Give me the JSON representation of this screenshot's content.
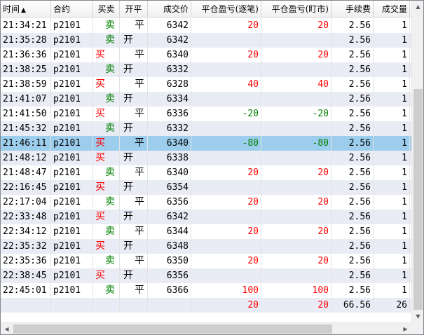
{
  "columns": [
    {
      "key": "time",
      "label": "时间",
      "sort_icon": "▲"
    },
    {
      "key": "contract",
      "label": "合约"
    },
    {
      "key": "side",
      "label": "买卖"
    },
    {
      "key": "offset",
      "label": "开平"
    },
    {
      "key": "price",
      "label": "成交价"
    },
    {
      "key": "pnl_close",
      "label": "平仓盈亏(逐笔)"
    },
    {
      "key": "pnl_mark",
      "label": "平仓盈亏(盯市)"
    },
    {
      "key": "fee",
      "label": "手续费"
    },
    {
      "key": "qty",
      "label": "成交量"
    }
  ],
  "colors": {
    "buy": "#ff0000",
    "sell": "#008000",
    "profit": "#ff0000",
    "loss": "#008000",
    "selected_row": "#9ccdec"
  },
  "rows": [
    {
      "time": "21:34:21",
      "contract": "p2101",
      "side": "卖",
      "offset": "平",
      "price": "6342",
      "pnl_close": "20",
      "pnl_mark": "20",
      "fee": "2.56",
      "qty": "1"
    },
    {
      "time": "21:35:28",
      "contract": "p2101",
      "side": "卖",
      "offset": "开",
      "price": "6342",
      "pnl_close": "",
      "pnl_mark": "",
      "fee": "2.56",
      "qty": "1"
    },
    {
      "time": "21:36:36",
      "contract": "p2101",
      "side": "买",
      "offset": "平",
      "price": "6340",
      "pnl_close": "20",
      "pnl_mark": "20",
      "fee": "2.56",
      "qty": "1"
    },
    {
      "time": "21:38:25",
      "contract": "p2101",
      "side": "卖",
      "offset": "开",
      "price": "6332",
      "pnl_close": "",
      "pnl_mark": "",
      "fee": "2.56",
      "qty": "1"
    },
    {
      "time": "21:38:59",
      "contract": "p2101",
      "side": "买",
      "offset": "平",
      "price": "6328",
      "pnl_close": "40",
      "pnl_mark": "40",
      "fee": "2.56",
      "qty": "1"
    },
    {
      "time": "21:41:07",
      "contract": "p2101",
      "side": "卖",
      "offset": "开",
      "price": "6334",
      "pnl_close": "",
      "pnl_mark": "",
      "fee": "2.56",
      "qty": "1"
    },
    {
      "time": "21:41:50",
      "contract": "p2101",
      "side": "买",
      "offset": "平",
      "price": "6336",
      "pnl_close": "-20",
      "pnl_mark": "-20",
      "fee": "2.56",
      "qty": "1"
    },
    {
      "time": "21:45:32",
      "contract": "p2101",
      "side": "卖",
      "offset": "开",
      "price": "6332",
      "pnl_close": "",
      "pnl_mark": "",
      "fee": "2.56",
      "qty": "1"
    },
    {
      "time": "21:46:11",
      "contract": "p2101",
      "side": "买",
      "offset": "平",
      "price": "6340",
      "pnl_close": "-80",
      "pnl_mark": "-80",
      "fee": "2.56",
      "qty": "1",
      "selected": true
    },
    {
      "time": "21:48:12",
      "contract": "p2101",
      "side": "买",
      "offset": "开",
      "price": "6338",
      "pnl_close": "",
      "pnl_mark": "",
      "fee": "2.56",
      "qty": "1"
    },
    {
      "time": "21:48:47",
      "contract": "p2101",
      "side": "卖",
      "offset": "平",
      "price": "6340",
      "pnl_close": "20",
      "pnl_mark": "20",
      "fee": "2.56",
      "qty": "1"
    },
    {
      "time": "22:16:45",
      "contract": "p2101",
      "side": "买",
      "offset": "开",
      "price": "6354",
      "pnl_close": "",
      "pnl_mark": "",
      "fee": "2.56",
      "qty": "1"
    },
    {
      "time": "22:17:04",
      "contract": "p2101",
      "side": "卖",
      "offset": "平",
      "price": "6356",
      "pnl_close": "20",
      "pnl_mark": "20",
      "fee": "2.56",
      "qty": "1"
    },
    {
      "time": "22:33:48",
      "contract": "p2101",
      "side": "买",
      "offset": "开",
      "price": "6342",
      "pnl_close": "",
      "pnl_mark": "",
      "fee": "2.56",
      "qty": "1"
    },
    {
      "time": "22:34:12",
      "contract": "p2101",
      "side": "卖",
      "offset": "平",
      "price": "6344",
      "pnl_close": "20",
      "pnl_mark": "20",
      "fee": "2.56",
      "qty": "1"
    },
    {
      "time": "22:35:32",
      "contract": "p2101",
      "side": "买",
      "offset": "开",
      "price": "6348",
      "pnl_close": "",
      "pnl_mark": "",
      "fee": "2.56",
      "qty": "1"
    },
    {
      "time": "22:35:36",
      "contract": "p2101",
      "side": "卖",
      "offset": "平",
      "price": "6350",
      "pnl_close": "20",
      "pnl_mark": "20",
      "fee": "2.56",
      "qty": "1"
    },
    {
      "time": "22:38:45",
      "contract": "p2101",
      "side": "买",
      "offset": "开",
      "price": "6356",
      "pnl_close": "",
      "pnl_mark": "",
      "fee": "2.56",
      "qty": "1"
    },
    {
      "time": "22:45:01",
      "contract": "p2101",
      "side": "卖",
      "offset": "平",
      "price": "6366",
      "pnl_close": "100",
      "pnl_mark": "100",
      "fee": "2.56",
      "qty": "1"
    }
  ],
  "totals": {
    "time": "",
    "contract": "",
    "side": "",
    "offset": "",
    "price": "",
    "pnl_close": "20",
    "pnl_mark": "20",
    "fee": "66.56",
    "qty": "26"
  },
  "icons": {
    "scroll_up": "arrow-up-icon",
    "scroll_down": "arrow-down-icon",
    "scroll_left": "arrow-left-icon",
    "scroll_right": "arrow-right-icon"
  }
}
